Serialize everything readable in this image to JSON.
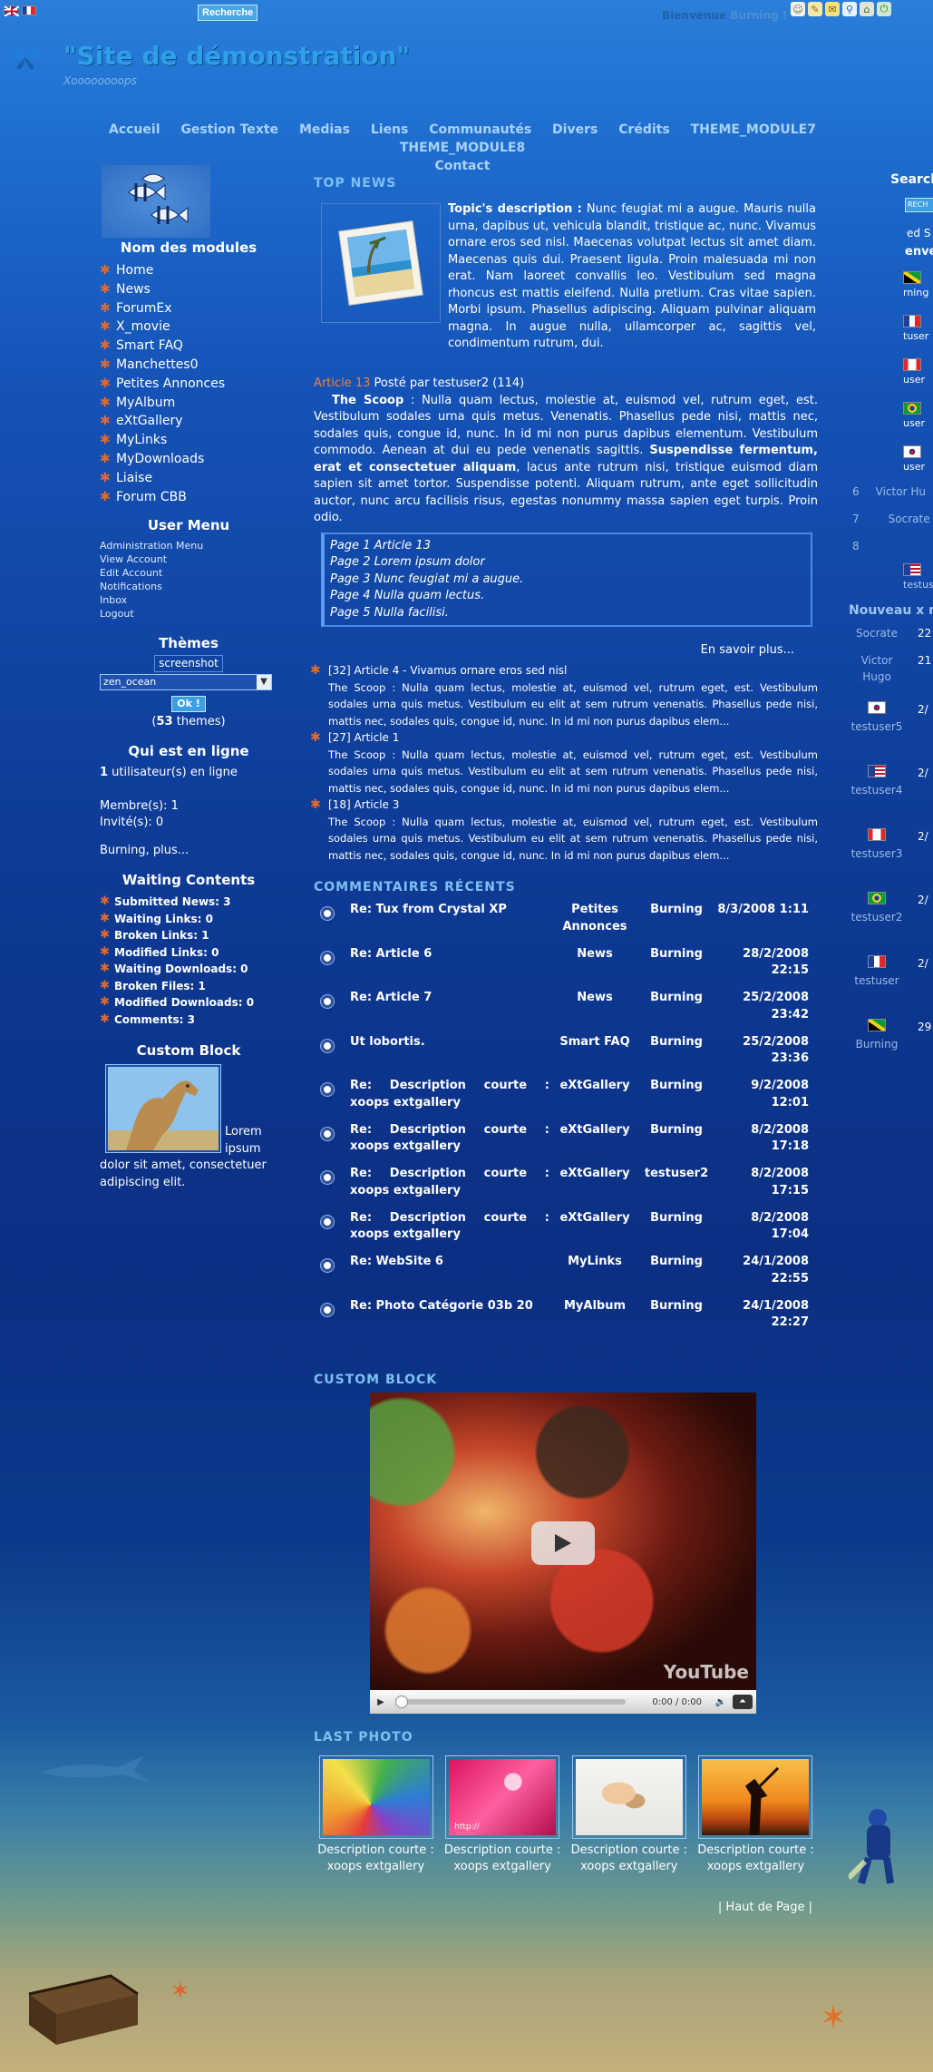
{
  "topbar": {
    "search_button": "Recherche",
    "welcome_prefix": "Bienvenue",
    "welcome_user": "Burning",
    "welcome_suffix": "!"
  },
  "header": {
    "site_title": "\"Site de démonstration\"",
    "slogan": "Xoooooooops"
  },
  "mainnav": [
    "Accueil",
    "Gestion Texte",
    "Medias",
    "Liens",
    "Communautés",
    "Divers",
    "Crédits",
    "THEME_MODULE7",
    "THEME_MODULE8",
    "Contact"
  ],
  "left": {
    "modules_title": "Nom des modules",
    "modules": [
      "Home",
      "News",
      "ForumEx",
      "X_movie",
      "Smart FAQ",
      "Manchettes0",
      "Petites Annonces",
      "MyAlbum",
      "eXtGallery",
      "MyLinks",
      "MyDownloads",
      "Liaise",
      "Forum CBB"
    ],
    "user_menu_title": "User Menu",
    "user_menu": [
      "Administration Menu",
      "View Account",
      "Edit Account",
      "Notifications",
      "Inbox",
      "Logout"
    ],
    "themes_title": "Thèmes",
    "themes_screenshot": "screenshot",
    "themes_select": "zen_ocean",
    "themes_ok": "Ok !",
    "themes_count_pre": "(",
    "themes_count": "53",
    "themes_count_post": " themes)",
    "online_title": "Qui est en ligne",
    "online_users": "1",
    "online_users_text": " utilisateur(s) en ligne",
    "members": "Membre(s):  1",
    "guests": "Invité(s):  0",
    "online_more": "Burning, plus...",
    "waiting_title": "Waiting Contents",
    "waiting": [
      "Submitted News: 3",
      "Waiting Links: 0",
      "Broken Links: 1",
      "Modified Links: 0",
      "Waiting Downloads: 0",
      "Broken Files: 1",
      "Modified Downloads: 0",
      "Comments: 3"
    ],
    "custom_title": "Custom Block",
    "custom_text": "Lorem ipsum dolor sit amet, consectetuer adipiscing elit."
  },
  "center": {
    "top_news_title": "TOP NEWS",
    "topic_label": "Topic's description :",
    "topic_text": " Nunc feugiat mi a augue. Mauris nulla urna, dapibus ut, vehicula blandit, tristique ac, nunc. Vivamus ornare eros sed nisl. Maecenas volutpat lectus sit amet diam. Maecenas quis dui. Praesent ligula. Proin malesuada mi non erat. Nam laoreet convallis leo. Vestibulum sed magna rhoncus est mattis eleifend. Nulla pretium. Cras vitae sapien. Morbi ipsum. Phasellus adipiscing. Aliquam pulvinar aliquam magna. In augue nulla, ullamcorper ac, sagittis vel, condimentum rutrum, dui.",
    "article_title": "Article 13",
    "article_meta": " Posté par testuser2 (114)",
    "scoop_label": "The Scoop",
    "scoop_text": " : Nulla quam lectus, molestie at, euismod vel, rutrum eget, est. Vestibulum sodales urna quis metus. Venenatis. Phasellus pede nisi, mattis nec, sodales quis, congue id, nunc. In id mi non purus dapibus elementum. Vestibulum commodo. Aenean at dui eu pede venenatis sagittis. ",
    "scoop_bold": "Suspendisse fermentum, erat et consectetuer aliquam",
    "scoop_text2": ", lacus ante rutrum nisi, tristique euismod diam sapien sit amet tortor. Suspendisse potenti. Aliquam rutrum, ante eget sollicitudin auctor, nunc arcu facilisis risus, egestas nonummy massa sapien eget turpis. Proin odio.",
    "pages": [
      "Page 1 Article 13",
      "Page 2 Lorem ipsum dolor",
      "Page 3 Nunc feugiat mi a augue.",
      "Page 4 Nulla quam lectus.",
      "Page 5 Nulla facilisi."
    ],
    "read_more": "En savoir plus...",
    "news": [
      {
        "title": "[32] Article 4 - Vivamus ornare eros sed nisl",
        "text": "The Scoop : Nulla quam lectus, molestie at, euismod vel, rutrum eget, est. Vestibulum sodales urna quis metus. Vestibulum eu elit at sem rutrum venenatis. Phasellus pede nisi, mattis nec, sodales quis, congue id, nunc. In id mi non purus dapibus elem..."
      },
      {
        "title": "[27] Article 1",
        "text": "The Scoop : Nulla quam lectus, molestie at, euismod vel, rutrum eget, est. Vestibulum sodales urna quis metus. Vestibulum eu elit at sem rutrum venenatis. Phasellus pede nisi, mattis nec, sodales quis, congue id, nunc. In id mi non purus dapibus elem..."
      },
      {
        "title": "[18] Article 3",
        "text": "The Scoop : Nulla quam lectus, molestie at, euismod vel, rutrum eget, est. Vestibulum sodales urna quis metus. Vestibulum eu elit at sem rutrum venenatis. Phasellus pede nisi, mattis nec, sodales quis, congue id, nunc. In id mi non purus dapibus elem..."
      }
    ],
    "comments_title": "COMMENTAIRES RÉCENTS",
    "comments": [
      {
        "title": "Re: Tux from Crystal XP",
        "module": "Petites Annonces",
        "user": "Burning",
        "date": "8/3/2008 1:11"
      },
      {
        "title": "Re: Article 6",
        "module": "News",
        "user": "Burning",
        "date": "28/2/2008 22:15"
      },
      {
        "title": "Re: Article 7",
        "module": "News",
        "user": "Burning",
        "date": "25/2/2008 23:42"
      },
      {
        "title": "Ut lobortis.",
        "module": "Smart FAQ",
        "user": "Burning",
        "date": "25/2/2008 23:36"
      },
      {
        "title": "Re: Description courte : xoops extgallery",
        "module": "eXtGallery",
        "user": "Burning",
        "date": "9/2/2008 12:01"
      },
      {
        "title": "Re: Description courte : xoops extgallery",
        "module": "eXtGallery",
        "user": "Burning",
        "date": "8/2/2008 17:18"
      },
      {
        "title": "Re: Description courte : xoops extgallery",
        "module": "eXtGallery",
        "user": "testuser2",
        "date": "8/2/2008 17:15"
      },
      {
        "title": "Re: Description courte : xoops extgallery",
        "module": "eXtGallery",
        "user": "Burning",
        "date": "8/2/2008 17:04"
      },
      {
        "title": "Re: WebSite 6",
        "module": "MyLinks",
        "user": "Burning",
        "date": "24/1/2008 22:55"
      },
      {
        "title": "Re: Photo Catégorie 03b 20",
        "module": "MyAlbum",
        "user": "Burning",
        "date": "24/1/2008 22:27"
      }
    ],
    "custom_block_title": "CUSTOM BLOCK",
    "video_time": "0:00 / 0:00",
    "video_brand": "YouTube",
    "last_photo_title": "LAST PHOTO",
    "photos": [
      {
        "caption": "Description courte : xoops extgallery"
      },
      {
        "caption": "Description courte : xoops extgallery",
        "watermark": "http://"
      },
      {
        "caption": "Description courte : xoops extgallery"
      },
      {
        "caption": "Description courte : xoops extgallery"
      }
    ],
    "back_to_top": "| Haut de Page |"
  },
  "right": {
    "search_title": "Search",
    "search_btn": "RECH",
    "ed": "ed S",
    "env": "enve",
    "users_top": [
      "rning",
      "tuser",
      "user",
      "user",
      "user"
    ],
    "ranks": [
      "6",
      "7",
      "8"
    ],
    "rank_names": [
      "Victor Hu",
      "Socrate",
      ""
    ],
    "testuser_label": "testuser",
    "nouveaux_title": "Nouveau x me",
    "new_members": [
      {
        "name": "Socrate",
        "val": "22"
      },
      {
        "name": "Victor Hugo",
        "val": "21"
      },
      {
        "name": "testuser5",
        "val": "2/"
      },
      {
        "name": "testuser4",
        "val": "2/"
      },
      {
        "name": "testuser3",
        "val": "2/"
      },
      {
        "name": "testuser2",
        "val": "2/"
      },
      {
        "name": "testuser",
        "val": "2/"
      },
      {
        "name": "Burning",
        "val": "29"
      }
    ]
  },
  "colors": {
    "accent": "#7cc0f2",
    "star": "#e36a2d",
    "link_orange": "#e9833a"
  }
}
